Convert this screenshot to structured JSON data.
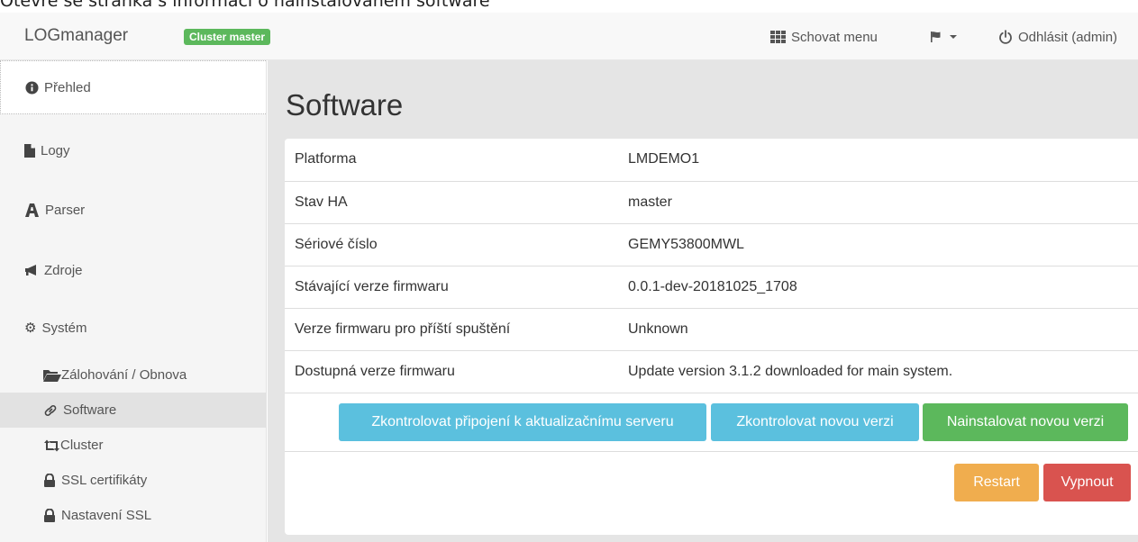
{
  "caption": "Otevře se stránka s informací o nainstalovaném software",
  "navbar": {
    "brand": "LOGmanager",
    "badge": "Cluster master",
    "hide_menu": "Schovat menu",
    "logout": "Odhlásit (admin)"
  },
  "sidebar": {
    "items": [
      {
        "label": "Přehled",
        "icon": "info-circle-icon"
      },
      {
        "label": "Logy",
        "icon": "file-icon"
      },
      {
        "label": "Parser",
        "icon": "tower-icon"
      },
      {
        "label": "Zdroje",
        "icon": "bullhorn-icon"
      },
      {
        "label": "Systém",
        "icon": "cog-icon"
      }
    ],
    "subitems": [
      {
        "label": "Zálohování / Obnova",
        "icon": "folder-open-icon"
      },
      {
        "label": "Software",
        "icon": "link-icon",
        "active": true
      },
      {
        "label": "Cluster",
        "icon": "retweet-icon"
      },
      {
        "label": "SSL certifikáty",
        "icon": "lock-icon"
      },
      {
        "label": "Nastavení SSL",
        "icon": "lock-icon"
      }
    ]
  },
  "main": {
    "title": "Software",
    "rows": [
      {
        "key": "Platforma",
        "value": "LMDEMO1"
      },
      {
        "key": "Stav HA",
        "value": "master"
      },
      {
        "key": "Sériové číslo",
        "value": "GEMY53800MWL"
      },
      {
        "key": "Stávající verze firmwaru",
        "value": "0.0.1-dev-20181025_1708"
      },
      {
        "key": "Verze firmwaru pro příští spuštění",
        "value": "Unknown"
      },
      {
        "key": "Dostupná verze firmwaru",
        "value": "Update version 3.1.2 downloaded for main system."
      }
    ],
    "buttons": {
      "check_connection": "Zkontrolovat připojení k aktualizačnímu serveru",
      "check_version": "Zkontrolovat novou verzi",
      "install": "Nainstalovat novou verzi",
      "restart": "Restart",
      "shutdown": "Vypnout"
    }
  },
  "colors": {
    "info": "#5bc0de",
    "success": "#5cb85c",
    "warning": "#f0ad4e",
    "danger": "#d9534f"
  }
}
